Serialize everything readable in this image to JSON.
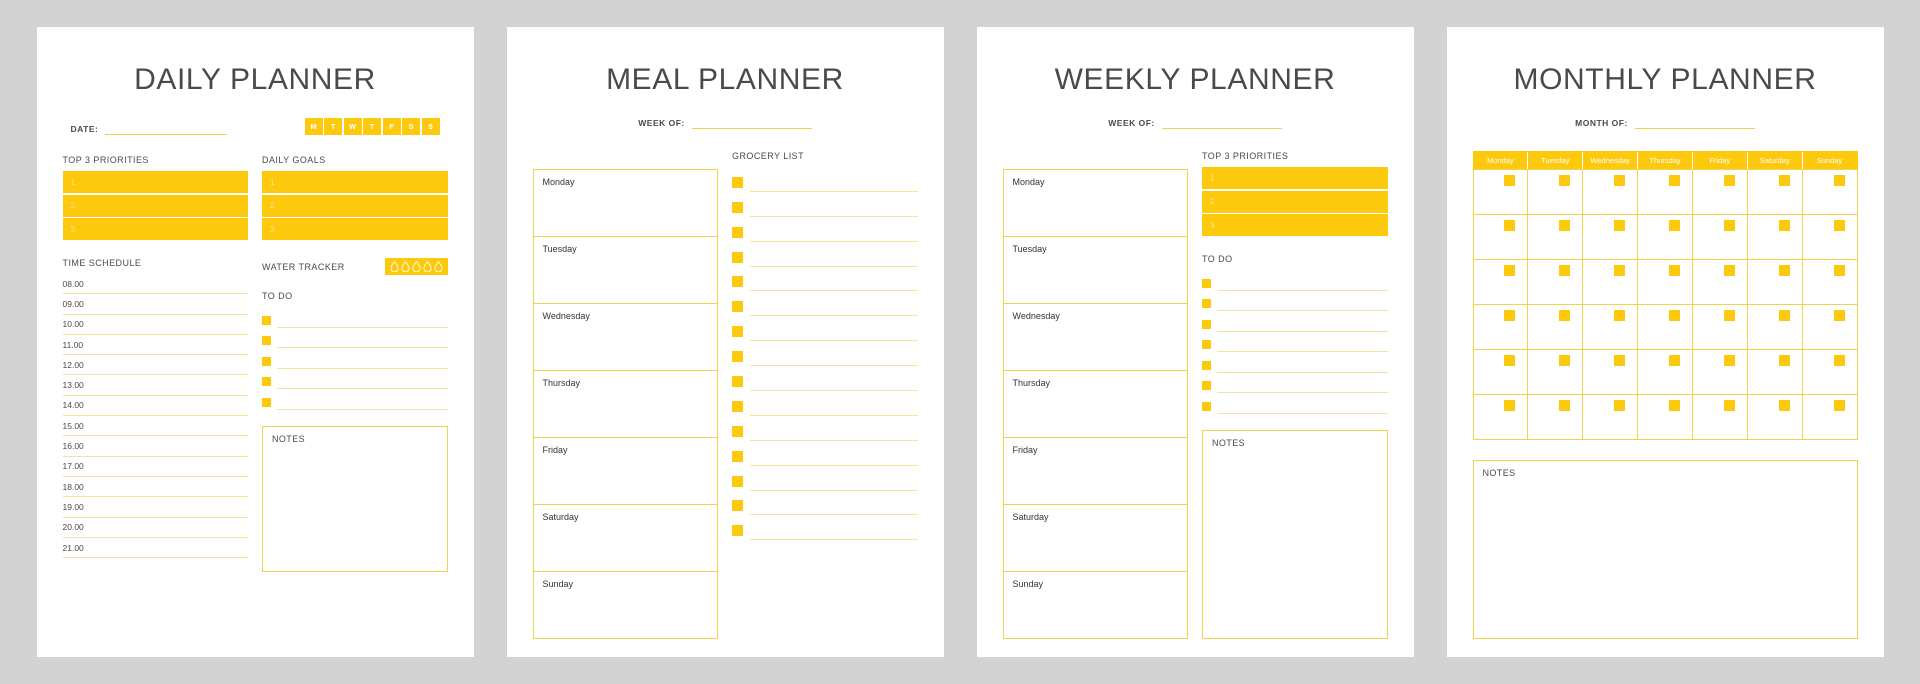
{
  "theme": {
    "accent": "#fcc90d",
    "line": "#f2d24a",
    "soft_line": "#f5e39a",
    "text": "#4a4a4a",
    "page_bg": "#d3d3d3",
    "sheet_bg": "#ffffff"
  },
  "daily": {
    "title": "DAILY PLANNER",
    "date_label": "DATE:",
    "day_badges": [
      "M",
      "T",
      "W",
      "T",
      "F",
      "S",
      "S"
    ],
    "priorities_head": "TOP 3 PRIORITIES",
    "priorities": [
      "1",
      "2",
      "3"
    ],
    "goals_head": "DAILY GOALS",
    "goals": [
      "1",
      "2",
      "3"
    ],
    "schedule_head": "TIME SCHEDULE",
    "times": [
      "08.00",
      "09.00",
      "10.00",
      "11.00",
      "12.00",
      "13.00",
      "14.00",
      "15.00",
      "16.00",
      "17.00",
      "18.00",
      "19.00",
      "20.00",
      "21.00"
    ],
    "water_head": "WATER TRACKER",
    "water_drops": 5,
    "todo_head": "TO DO",
    "todo_count": 5,
    "notes_head": "NOTES"
  },
  "meal": {
    "title": "MEAL PLANNER",
    "week_label": "WEEK OF:",
    "days": [
      "Monday",
      "Tuesday",
      "Wednesday",
      "Thursday",
      "Friday",
      "Saturday",
      "Sunday"
    ],
    "grocery_head": "GROCERY LIST",
    "grocery_count": 15
  },
  "weekly": {
    "title": "WEEKLY PLANNER",
    "week_label": "WEEK OF:",
    "days": [
      "Monday",
      "Tuesday",
      "Wednesday",
      "Thursday",
      "Friday",
      "Saturday",
      "Sunday"
    ],
    "priorities_head": "TOP 3 PRIORITIES",
    "priorities": [
      "1",
      "2",
      "3"
    ],
    "todo_head": "TO DO",
    "todo_count": 7,
    "notes_head": "NOTES"
  },
  "monthly": {
    "title": "MONTHLY PLANNER",
    "month_label": "MONTH OF:",
    "weekdays": [
      "Monday",
      "Tuesday",
      "Wednesday",
      "Thursday",
      "Friday",
      "Saturday",
      "Sunday"
    ],
    "rows": 6,
    "notes_head": "NOTES"
  }
}
